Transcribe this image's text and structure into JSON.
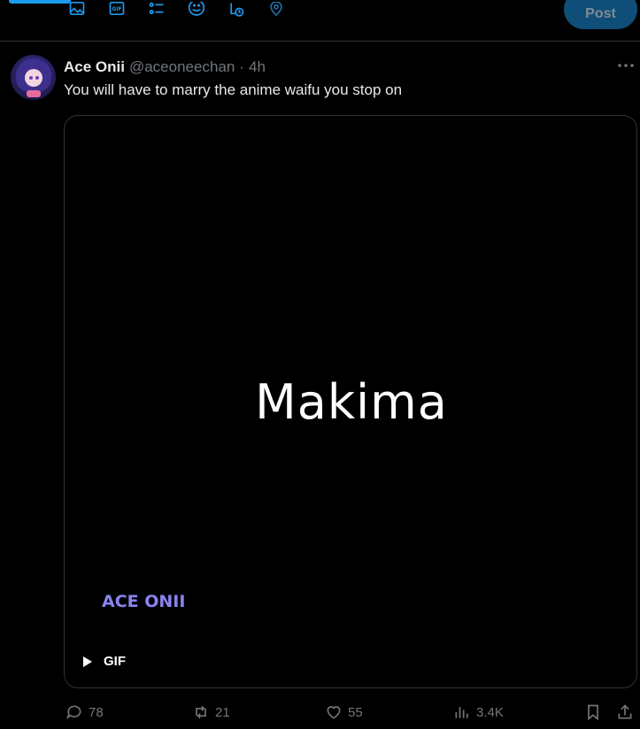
{
  "composer": {
    "post_label": "Post",
    "tools": [
      "media-icon",
      "gif-icon",
      "poll-icon",
      "emoji-icon",
      "schedule-icon",
      "location-icon"
    ],
    "accent_color": "#1d9bf0"
  },
  "tweet": {
    "display_name": "Ace Onii",
    "handle": "@aceoneechan",
    "separator": "·",
    "time": "4h",
    "text": "You will have to marry the anime waifu you stop on",
    "media": {
      "caption": "Makima",
      "watermark": "ACE ONII",
      "badge": "GIF"
    },
    "actions": {
      "replies": "78",
      "reposts": "21",
      "likes": "55",
      "views": "3.4K"
    }
  }
}
